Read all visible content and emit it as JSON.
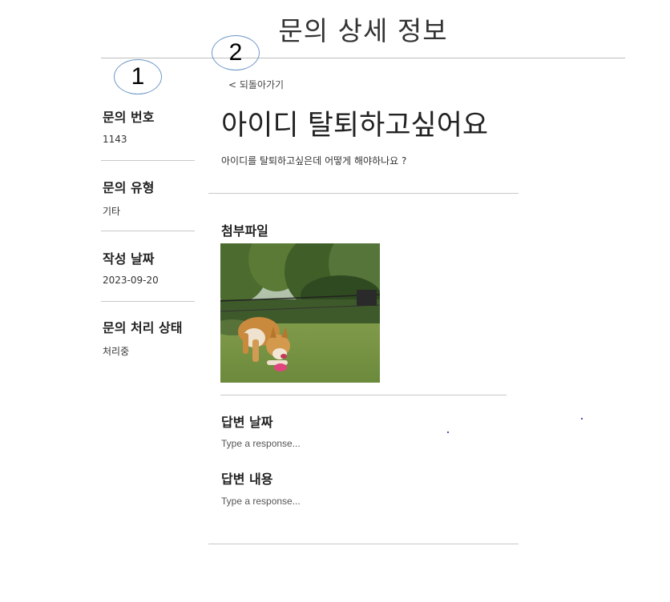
{
  "page": {
    "title": "문의 상세 정보"
  },
  "annotations": {
    "one": "1",
    "two": "2"
  },
  "sidebar": {
    "fields": [
      {
        "label": "문의 번호",
        "value": "1143"
      },
      {
        "label": "문의 유형",
        "value": "기타"
      },
      {
        "label": "작성 날짜",
        "value": "2023-09-20"
      },
      {
        "label": "문의 처리 상태",
        "value": "처리중"
      }
    ]
  },
  "main": {
    "back_label": "< 되돌아가기",
    "title": "아이디 탈퇴하고싶어요",
    "body": "아이디를 탈퇴하고싶은데 어떻게 해야하나요 ?",
    "attachment_label": "첨부파일",
    "answer_date_label": "답변 날짜",
    "answer_date_placeholder": "Type a response...",
    "answer_content_label": "답변 내용",
    "answer_content_placeholder": "Type a response..."
  }
}
